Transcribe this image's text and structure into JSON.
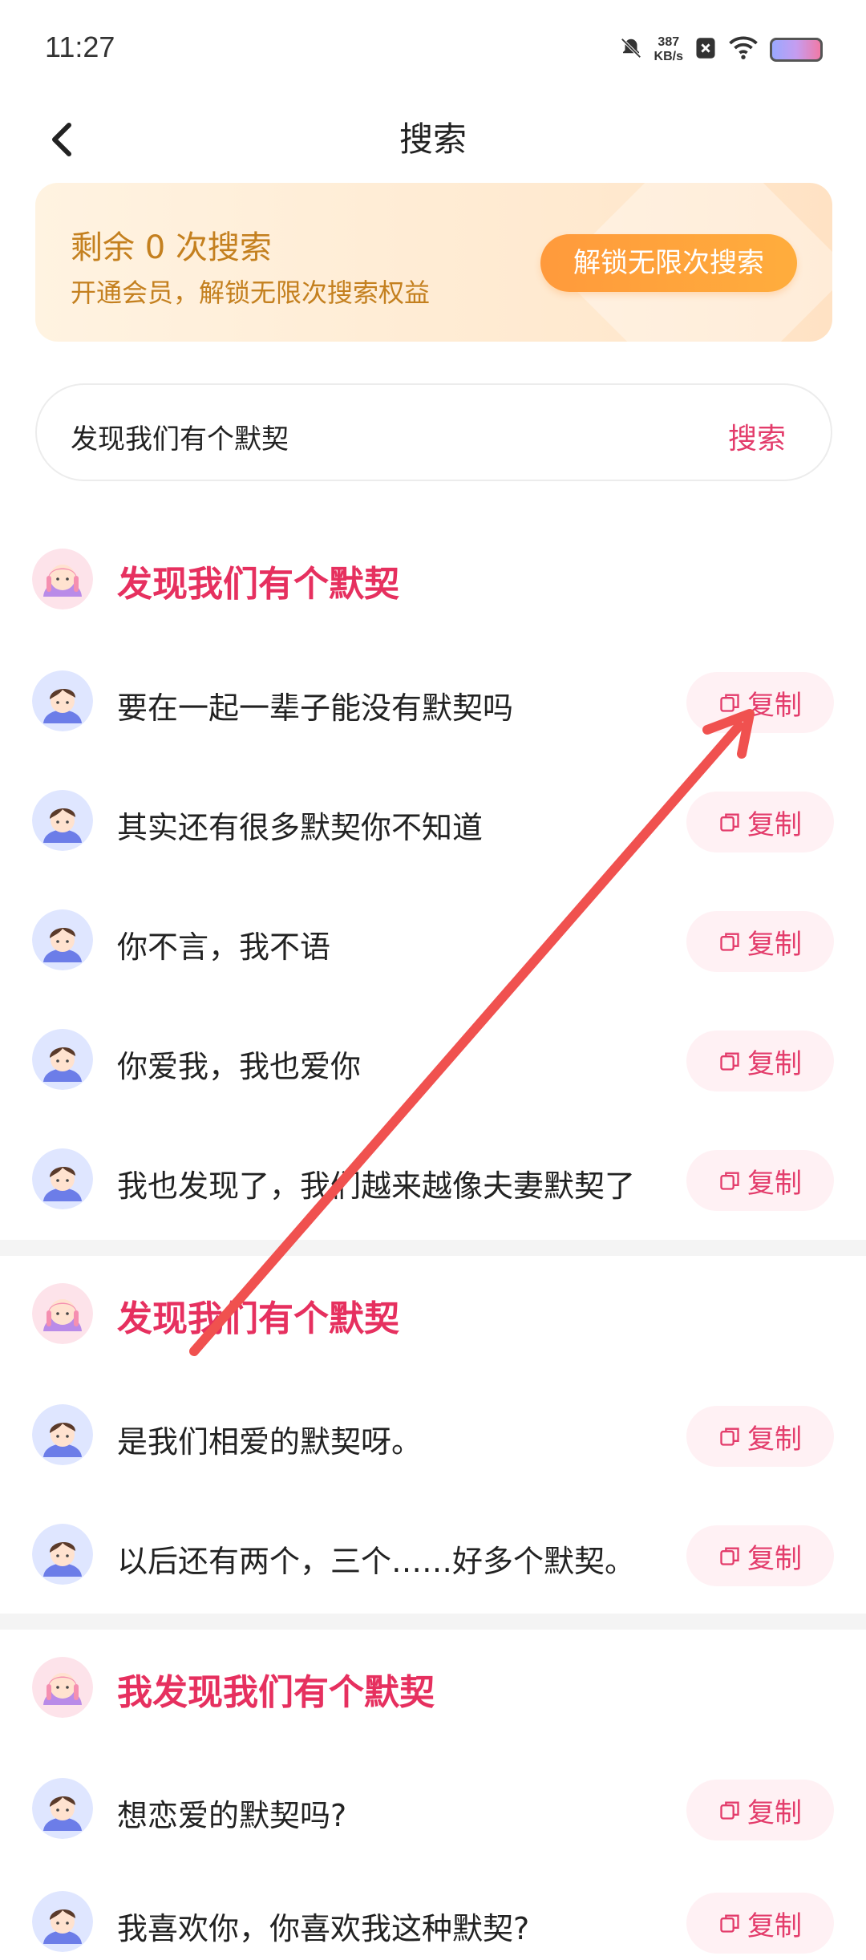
{
  "status_bar": {
    "time": "11:27",
    "net_speed_value": "387",
    "net_speed_unit": "KB/s"
  },
  "header": {
    "title": "搜索"
  },
  "vip_banner": {
    "title": "剩余 0 次搜索",
    "subtitle": "开通会员，解锁无限次搜索权益",
    "button": "解锁无限次搜索"
  },
  "search": {
    "query": "发现我们有个默契",
    "button": "搜索"
  },
  "copy_label": "复制",
  "groups": [
    {
      "title": "发现我们有个默契",
      "rows": [
        "要在一起一辈子能没有默契吗",
        "其实还有很多默契你不知道",
        "你不言，我不语",
        "你爱我，我也爱你",
        "我也发现了，我们越来越像夫妻默契了"
      ]
    },
    {
      "title": "发现我们有个默契",
      "rows": [
        "是我们相爱的默契呀。",
        "以后还有两个，三个……好多个默契。"
      ]
    },
    {
      "title": "我发现我们有个默契",
      "rows": [
        "想恋爱的默契吗?",
        "我喜欢你，你喜欢我这种默契?"
      ]
    }
  ],
  "colors": {
    "accent": "#e33c6b",
    "vip_text": "#c4801f",
    "unlock_button": "#ff9a3c",
    "annotation_arrow": "#f0514f"
  }
}
